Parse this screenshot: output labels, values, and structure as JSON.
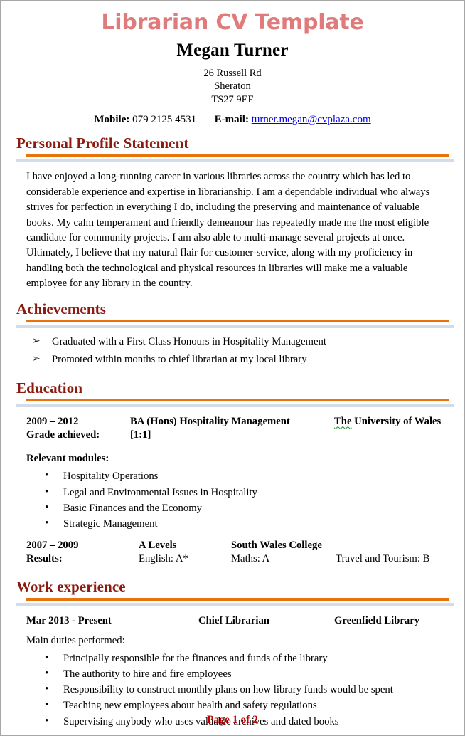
{
  "document": {
    "title": "Librarian CV Template",
    "footer": "Page 1 of 2"
  },
  "header": {
    "name": "Megan Turner",
    "address_line1": "26 Russell Rd",
    "address_line2": "Sheraton",
    "address_line3": "TS27 9EF",
    "mobile_label": "Mobile:",
    "mobile_value": "079 2125 4531",
    "email_label": "E-mail:",
    "email_value": "turner.megan@cvplaza.com",
    "email_color": "#0000ee"
  },
  "theme": {
    "title_color": "#e07b7b",
    "heading_color": "#8b1a0f",
    "rule_orange": "#e8730c",
    "rule_blue": "#d2dde9",
    "footer_color": "#c00000",
    "spellcheck_underline": "#1f8a2a",
    "page_border": "#a6a6a6"
  },
  "sections": {
    "profile": {
      "heading": "Personal Profile Statement",
      "text": "I have enjoyed a long-running career in various libraries across the country which has led to considerable experience and expertise in librarianship.  I am a dependable individual who always strives for perfection in everything I do, including the preserving and maintenance of valuable books. My calm temperament and friendly demeanour has repeatedly made me the most eligible candidate for community projects.  I am also able to multi-manage several projects at once. Ultimately, I believe that my natural flair for customer-service, along with my proficiency in handling both the technological and physical resources in libraries will make me a valuable employee for any library in the country."
    },
    "achievements": {
      "heading": "Achievements",
      "items": [
        "Graduated with a First Class Honours in Hospitality Management",
        "Promoted within months to chief librarian at my local library"
      ]
    },
    "education": {
      "heading": "Education",
      "entry1": {
        "dates": "2009 – 2012",
        "qualification": "BA (Hons) Hospitality  Management",
        "institution_prefix": "The",
        "institution_rest": " University of Wales",
        "grade_label": "Grade achieved:",
        "grade_value": "[1:1]"
      },
      "modules_label": "Relevant modules:",
      "modules": [
        "Hospitality Operations",
        "Legal and Environmental Issues in Hospitality",
        "Basic Finances and the Economy",
        "Strategic Management"
      ],
      "entry2": {
        "dates": "2007 – 2009",
        "qualification": "A Levels",
        "institution": "South Wales College",
        "results_label": "Results:",
        "result1": "English: A*",
        "result2": "Maths: A",
        "result3": "Travel and Tourism:  B"
      }
    },
    "work": {
      "heading": "Work experience",
      "entry1": {
        "dates": "Mar 2013 - Present",
        "role": "Chief Librarian",
        "employer": "Greenfield Library",
        "duties_label": "Main duties performed:",
        "duties": [
          "Principally responsible for the finances and funds of the library",
          "The authority to hire and fire employees",
          "Responsibility to construct monthly plans on how library funds would be spent",
          "Teaching new employees about health and safety regulations",
          "Supervising anybody who uses valuable archives and dated books"
        ]
      }
    }
  }
}
